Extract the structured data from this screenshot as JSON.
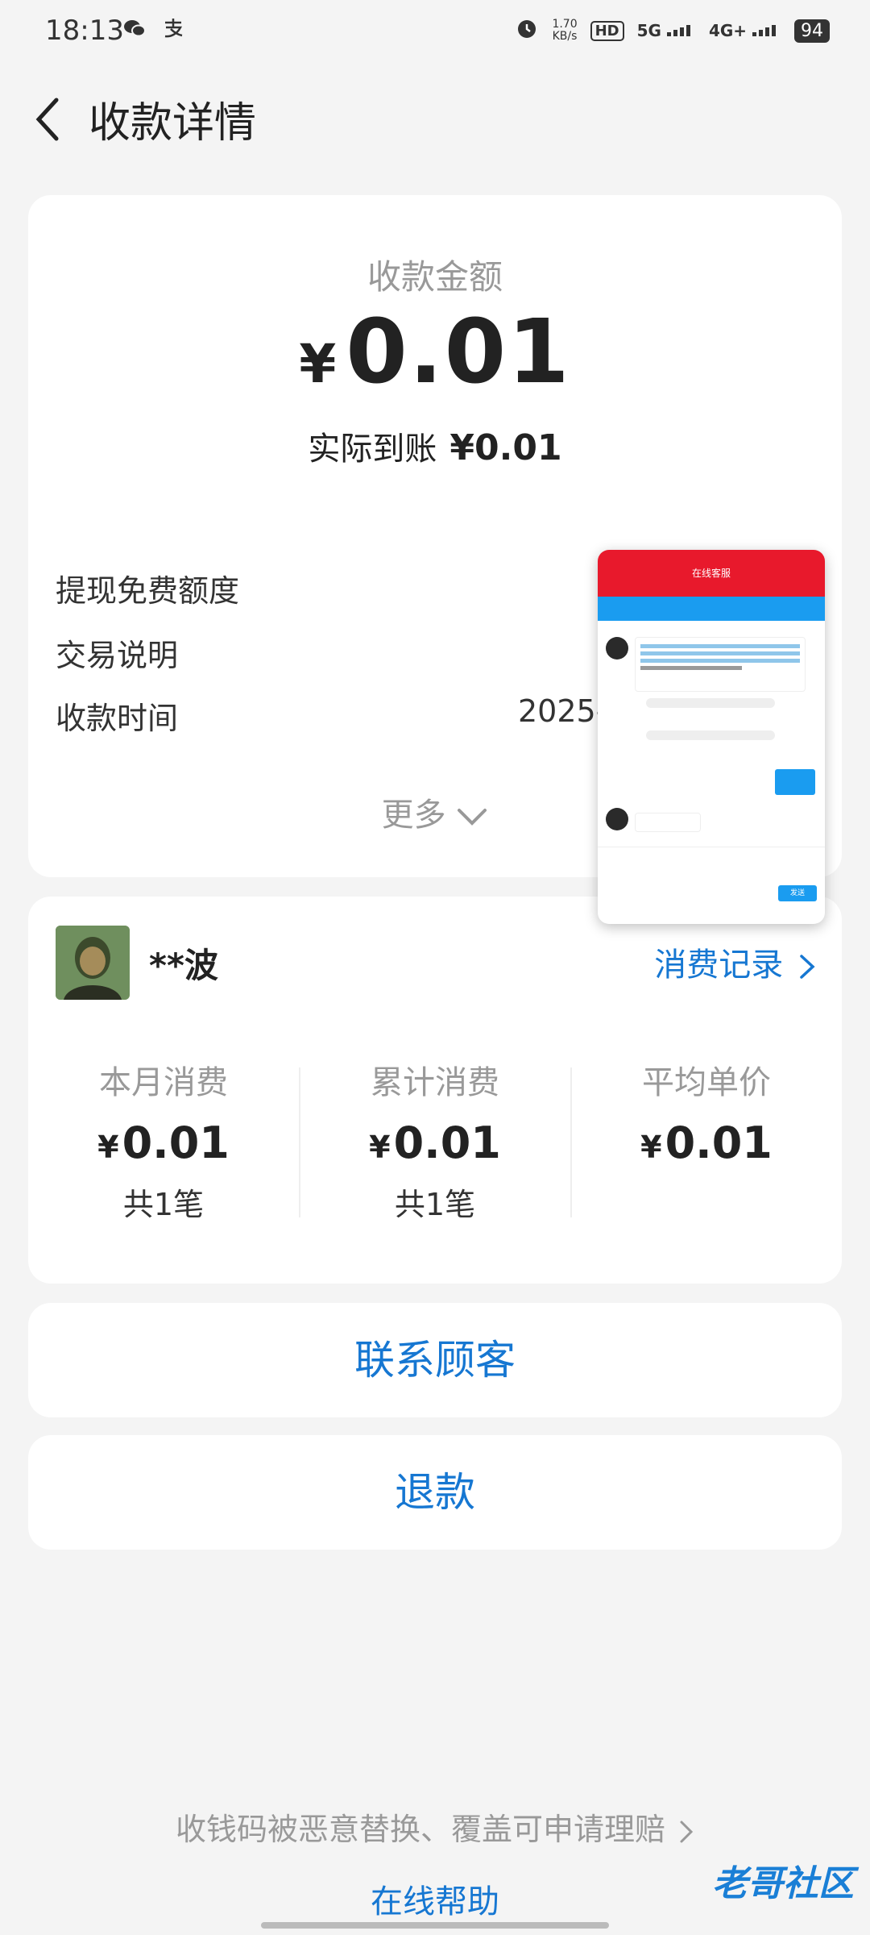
{
  "status_bar": {
    "time": "18:13",
    "left_icons": [
      "wechat-icon",
      "alipay-icon"
    ],
    "speed_value": "1.70",
    "speed_unit": "KB/s",
    "hd_label": "HD",
    "network_5g": "5G",
    "network_4g": "4G+",
    "battery": "94"
  },
  "header": {
    "title": "收款详情"
  },
  "summary": {
    "amount_label": "收款金额",
    "currency": "¥",
    "amount": "0.01",
    "actual_label": "实际到账",
    "actual_value": "¥0.01",
    "rows": [
      {
        "label": "提现免费额度",
        "value": ""
      },
      {
        "label": "交易说明",
        "value": ""
      },
      {
        "label": "收款时间",
        "value": "2025-"
      }
    ],
    "more_label": "更多"
  },
  "overlay": {
    "header_title": "在线客服",
    "send_label": "发送"
  },
  "customer": {
    "name": "**波",
    "records_label": "消费记录",
    "stats": [
      {
        "label": "本月消费",
        "currency": "¥",
        "value": "0.01",
        "count": "共1笔"
      },
      {
        "label": "累计消费",
        "currency": "¥",
        "value": "0.01",
        "count": "共1笔"
      },
      {
        "label": "平均单价",
        "currency": "¥",
        "value": "0.01",
        "count": ""
      }
    ]
  },
  "actions": {
    "contact_label": "联系顾客",
    "refund_label": "退款"
  },
  "footer": {
    "insurance_label": "收钱码被恶意替换、覆盖可申请理赔",
    "help_label": "在线帮助",
    "watermark": "老哥社区"
  },
  "colors": {
    "accent": "#1677d2",
    "background": "#f4f4f4"
  }
}
